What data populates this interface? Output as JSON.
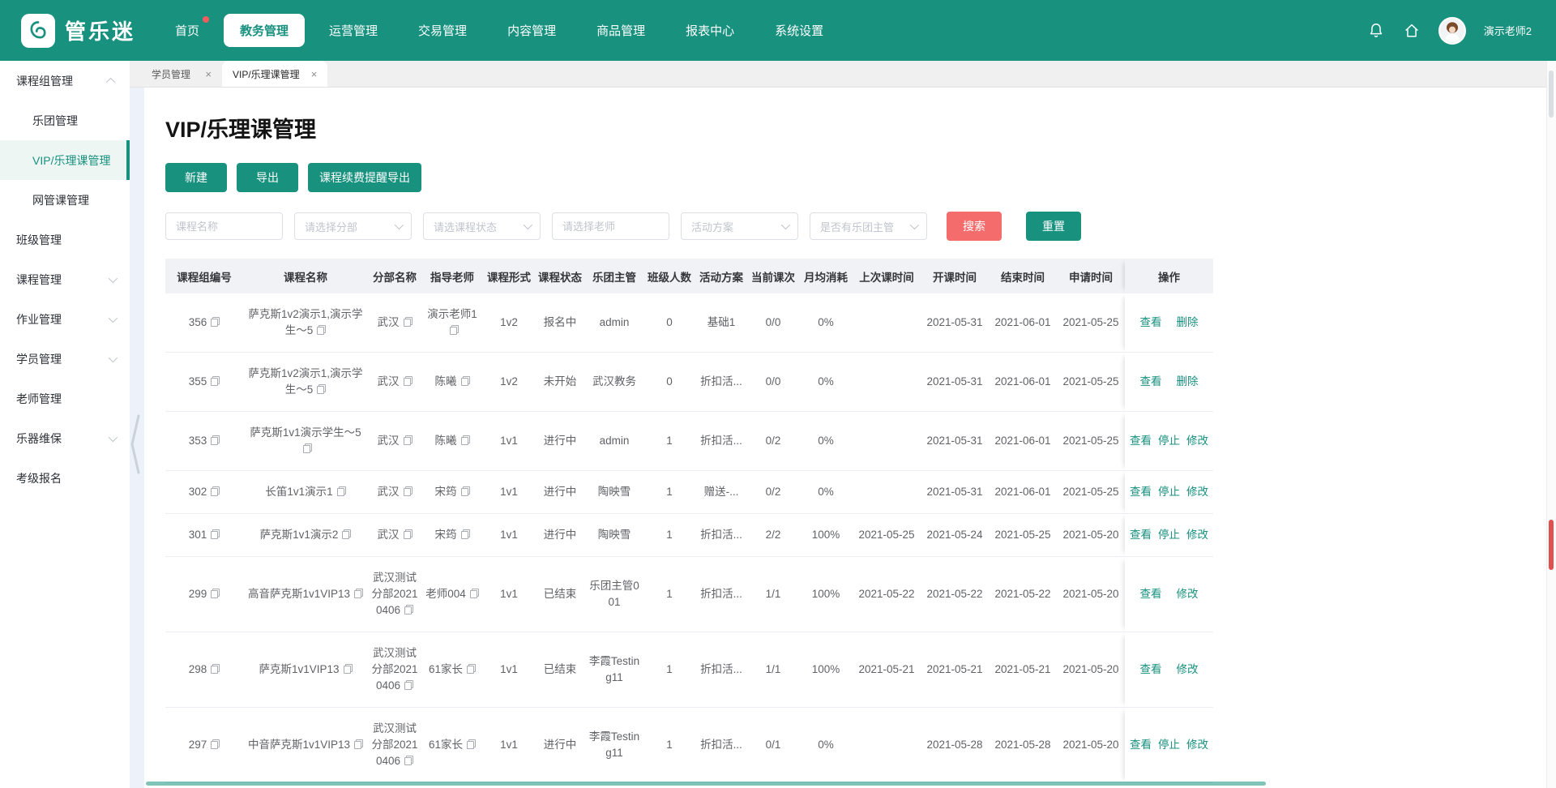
{
  "colors": {
    "accent": "#18917f",
    "danger": "#f56c6c"
  },
  "header": {
    "logo_text": "管乐迷",
    "nav_items": [
      {
        "label": "首页",
        "active": false,
        "badge": true
      },
      {
        "label": "教务管理",
        "active": true
      },
      {
        "label": "运营管理"
      },
      {
        "label": "交易管理"
      },
      {
        "label": "内容管理"
      },
      {
        "label": "商品管理"
      },
      {
        "label": "报表中心"
      },
      {
        "label": "系统设置"
      }
    ],
    "icons": [
      "bell-icon",
      "home-icon"
    ],
    "user_name": "演示老师2"
  },
  "sidebar": {
    "groups": [
      {
        "label": "课程组管理",
        "expanded": true,
        "children": [
          {
            "label": "乐团管理",
            "active": false
          },
          {
            "label": "VIP/乐理课管理",
            "active": true
          },
          {
            "label": "网管课管理",
            "active": false
          }
        ]
      },
      {
        "label": "班级管理"
      },
      {
        "label": "课程管理",
        "collapsible": true
      },
      {
        "label": "作业管理",
        "collapsible": true
      },
      {
        "label": "学员管理",
        "collapsible": true
      },
      {
        "label": "老师管理"
      },
      {
        "label": "乐器维保",
        "collapsible": true
      },
      {
        "label": "考级报名"
      }
    ]
  },
  "tabs": [
    {
      "label": "学员管理",
      "active": false
    },
    {
      "label": "VIP/乐理课管理",
      "active": true
    }
  ],
  "page": {
    "title": "VIP/乐理课管理",
    "action_buttons": [
      "新建",
      "导出",
      "课程续费提醒导出"
    ],
    "filters": [
      {
        "type": "input",
        "placeholder": "课程名称"
      },
      {
        "type": "select",
        "placeholder": "请选择分部"
      },
      {
        "type": "select",
        "placeholder": "请选课程状态"
      },
      {
        "type": "input",
        "placeholder": "请选择老师"
      },
      {
        "type": "select",
        "placeholder": "活动方案"
      },
      {
        "type": "select",
        "placeholder": "是否有乐团主管"
      }
    ],
    "search_label": "搜索",
    "reset_label": "重置"
  },
  "table": {
    "columns": [
      "课程组编号",
      "课程名称",
      "分部名称",
      "指导老师",
      "课程形式",
      "课程状态",
      "乐团主管",
      "班级人数",
      "活动方案",
      "当前课次",
      "月均消耗",
      "上次课时间",
      "开课时间",
      "结束时间",
      "申请时间",
      "操作"
    ],
    "copy_fields": [
      "id",
      "name",
      "branch",
      "teacher"
    ],
    "rows": [
      {
        "id": "356",
        "name": "萨克斯1v2演示1,演示学生～5",
        "branch": "武汉",
        "teacher": "演示老师1",
        "form": "1v2",
        "status": "报名中",
        "leader": "admin",
        "size": "0",
        "plan": "基础1",
        "current": "0/0",
        "monthly": "0%",
        "last": "",
        "start": "2021-05-31",
        "end": "2021-06-01",
        "apply": "2021-05-25",
        "actions": [
          "查看",
          "删除"
        ]
      },
      {
        "id": "355",
        "name": "萨克斯1v2演示1,演示学生～5",
        "branch": "武汉",
        "teacher": "陈曦",
        "form": "1v2",
        "status": "未开始",
        "leader": "武汉教务",
        "size": "0",
        "plan": "折扣活...",
        "current": "0/0",
        "monthly": "0%",
        "last": "",
        "start": "2021-05-31",
        "end": "2021-06-01",
        "apply": "2021-05-25",
        "actions": [
          "查看",
          "删除"
        ]
      },
      {
        "id": "353",
        "name": "萨克斯1v1演示学生～5",
        "branch": "武汉",
        "teacher": "陈曦",
        "form": "1v1",
        "status": "进行中",
        "leader": "admin",
        "size": "1",
        "plan": "折扣活...",
        "current": "0/2",
        "monthly": "0%",
        "last": "",
        "start": "2021-05-31",
        "end": "2021-06-01",
        "apply": "2021-05-25",
        "actions": [
          "查看",
          "停止",
          "修改"
        ]
      },
      {
        "id": "302",
        "name": "长笛1v1演示1",
        "branch": "武汉",
        "teacher": "宋筠",
        "form": "1v1",
        "status": "进行中",
        "leader": "陶映雪",
        "size": "1",
        "plan": "赠送-...",
        "current": "0/2",
        "monthly": "0%",
        "last": "",
        "start": "2021-05-31",
        "end": "2021-06-01",
        "apply": "2021-05-25",
        "actions": [
          "查看",
          "停止",
          "修改"
        ]
      },
      {
        "id": "301",
        "name": "萨克斯1v1演示2",
        "branch": "武汉",
        "teacher": "宋筠",
        "form": "1v1",
        "status": "进行中",
        "leader": "陶映雪",
        "size": "1",
        "plan": "折扣活...",
        "current": "2/2",
        "monthly": "100%",
        "last": "2021-05-25",
        "start": "2021-05-24",
        "end": "2021-05-25",
        "apply": "2021-05-20",
        "actions": [
          "查看",
          "停止",
          "修改"
        ]
      },
      {
        "id": "299",
        "name": "高音萨克斯1v1VIP13",
        "branch": "武汉测试分部20210406",
        "teacher": "老师004",
        "form": "1v1",
        "status": "已结束",
        "leader": "乐团主管001",
        "size": "1",
        "plan": "折扣活...",
        "current": "1/1",
        "monthly": "100%",
        "last": "2021-05-22",
        "start": "2021-05-22",
        "end": "2021-05-22",
        "apply": "2021-05-20",
        "actions": [
          "查看",
          "修改"
        ]
      },
      {
        "id": "298",
        "name": "萨克斯1v1VIP13",
        "branch": "武汉测试分部20210406",
        "teacher": "61家长",
        "form": "1v1",
        "status": "已结束",
        "leader": "李霞Testing11",
        "size": "1",
        "plan": "折扣活...",
        "current": "1/1",
        "monthly": "100%",
        "last": "2021-05-21",
        "start": "2021-05-21",
        "end": "2021-05-21",
        "apply": "2021-05-20",
        "actions": [
          "查看",
          "修改"
        ]
      },
      {
        "id": "297",
        "name": "中音萨克斯1v1VIP13",
        "branch": "武汉测试分部20210406",
        "teacher": "61家长",
        "form": "1v1",
        "status": "进行中",
        "leader": "李霞Testing11",
        "size": "1",
        "plan": "折扣活...",
        "current": "0/1",
        "monthly": "0%",
        "last": "",
        "start": "2021-05-28",
        "end": "2021-05-28",
        "apply": "2021-05-20",
        "actions": [
          "查看",
          "停止",
          "修改"
        ]
      }
    ]
  }
}
